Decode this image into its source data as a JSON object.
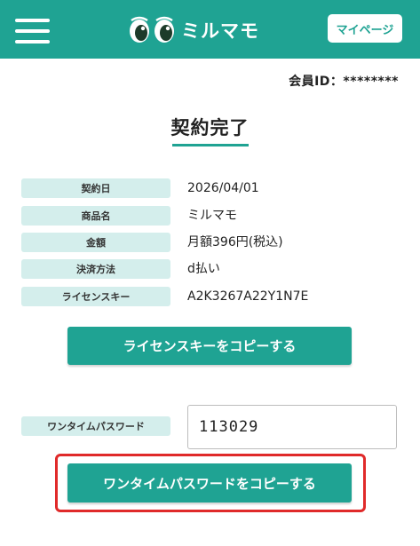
{
  "header": {
    "brand_color": "#1fa393",
    "menu_icon": "hamburger-icon",
    "logo_icon": "twin-eyes-icon",
    "logo_text": "ミルマモ",
    "mypage_label": "マイページ"
  },
  "member": {
    "id_text": "会員ID：********"
  },
  "page": {
    "title": "契約完了"
  },
  "contract_info": [
    {
      "label": "契約日",
      "value": "2026/04/01"
    },
    {
      "label": "商品名",
      "value": "ミルマモ"
    },
    {
      "label": "金額",
      "value": "月額396円(税込)"
    },
    {
      "label": "決済方法",
      "value": "d払い"
    },
    {
      "label": "ライセンスキー",
      "value": "A2K3267A22Y1N7E"
    }
  ],
  "actions": {
    "copy_license_label": "ライセンスキーをコピーする",
    "otp_label": "ワンタイムパスワード",
    "otp_value": "113029",
    "copy_otp_label": "ワンタイムパスワードをコピーする"
  },
  "highlight_color": "#e02a2a"
}
